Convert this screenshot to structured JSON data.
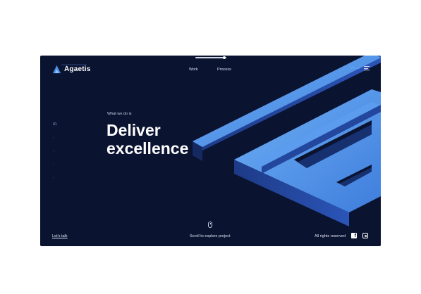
{
  "brand": {
    "name": "Ágaetis"
  },
  "nav": {
    "work": "Work",
    "process": "Process",
    "menu": "Menu"
  },
  "hero": {
    "eyebrow": "What we do is",
    "line1": "Deliver",
    "line2": "excellence"
  },
  "side_index": {
    "active": "01"
  },
  "footer": {
    "lets_talk": "Let's talk",
    "scroll": "Scroll to explore project",
    "rights": "All rights reserved"
  },
  "icons": {
    "logo": "agaetis-logo-icon",
    "menu": "hamburger-icon",
    "scroll": "mouse-icon",
    "facebook": "facebook-icon",
    "instagram": "instagram-icon"
  },
  "colors": {
    "background": "#0a1330",
    "accent": "#5ea7ff",
    "shape_light": "#4d8fe6",
    "shape_dark": "#1e3c8c"
  }
}
